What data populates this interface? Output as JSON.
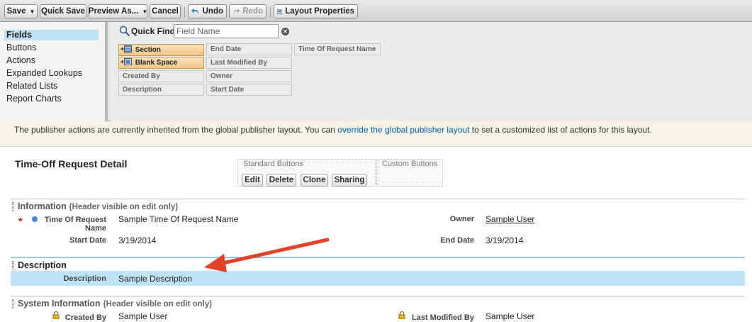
{
  "toolbar": {
    "save": "Save",
    "quick_save": "Quick Save",
    "preview_as": "Preview As...",
    "cancel": "Cancel",
    "undo": "Undo",
    "redo": "Redo",
    "layout_properties": "Layout Properties"
  },
  "palette": {
    "categories": [
      "Fields",
      "Buttons",
      "Actions",
      "Expanded Lookups",
      "Related Lists",
      "Report Charts"
    ],
    "active_category": "Fields",
    "quick_find_label": "Quick Find",
    "quick_find_placeholder": "Field Name",
    "items": [
      "Section",
      "Blank Space",
      "Created By",
      "Description",
      "End Date",
      "Last Modified By",
      "Owner",
      "Start Date",
      "Time Of Request Name"
    ]
  },
  "notice": {
    "before": "The publisher actions are currently inherited from the global publisher layout. You can ",
    "link": "override the global publisher layout",
    "after": " to set a customized list of actions for this layout."
  },
  "detail": {
    "title": "Time-Off Request Detail",
    "standard_buttons_label": "Standard Buttons",
    "custom_buttons_label": "Custom Buttons",
    "buttons": [
      "Edit",
      "Delete",
      "Clone",
      "Sharing"
    ]
  },
  "sections": {
    "information": {
      "title": "Information",
      "hint": "(Header visible on edit only)",
      "fields": {
        "time_of_request_label": "Time Of Request Name",
        "time_of_request_value": "Sample Time Of Request Name",
        "owner_label": "Owner",
        "owner_value": "Sample User",
        "start_date_label": "Start Date",
        "start_date_value": "3/19/2014",
        "end_date_label": "End Date",
        "end_date_value": "3/19/2014"
      }
    },
    "description": {
      "title": "Description",
      "field_label": "Description",
      "field_value": "Sample Description"
    },
    "system": {
      "title": "System Information",
      "hint": "(Header visible on edit only)",
      "created_by_label": "Created By",
      "created_by_value": "Sample User",
      "last_modified_label": "Last Modified By",
      "last_modified_value": "Sample User"
    }
  },
  "colors": {
    "highlight_row": "#bfe4f7",
    "active_category": "#bfe1f6",
    "arrow": "#e0422a"
  }
}
